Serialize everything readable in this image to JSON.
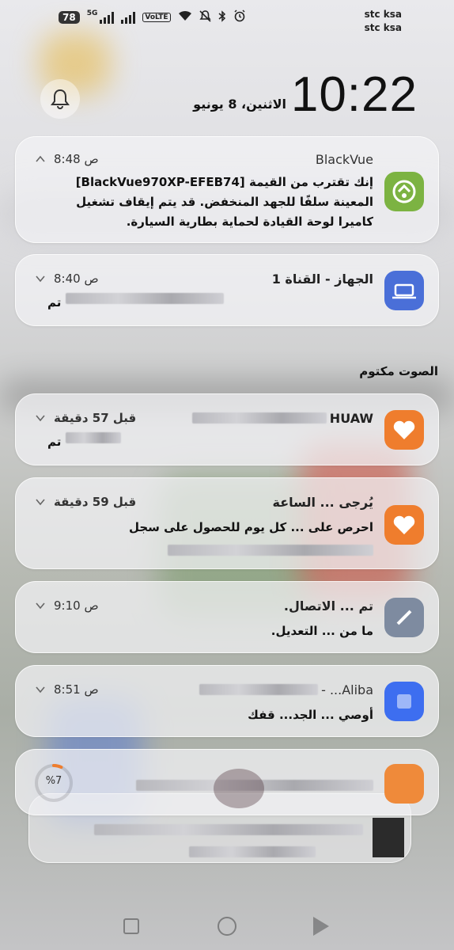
{
  "status_bar": {
    "battery": "78",
    "network": "5G",
    "volte": "VoLTE",
    "carrier_line1": "stc ksa",
    "carrier_line2": "stc ksa"
  },
  "lockscreen": {
    "time": "10:22",
    "date": "الاثنين، 8 يونيو"
  },
  "notifications": [
    {
      "app": "BlackVue",
      "time": "8:48 ص",
      "body": "إنك تقترب من القيمة [BlackVue970XP-EFEB74] المعينة سلفًا للجهد المنخفض. قد يتم إيقاف تشغيل كاميرا لوحة القيادة لحماية بطارية السيارة.",
      "icon_color": "#7cb342"
    },
    {
      "title": "الجهاز - القناة 1",
      "time": "8:40 ص",
      "body": "تم",
      "icon_color": "#4a6fd8"
    }
  ],
  "silent_section": {
    "label": "الصوت مكتوم"
  },
  "silent_notifications": [
    {
      "title": "HUAW",
      "time": "قبل 57 دقيقة",
      "body": "تم",
      "icon_color": "#ef7d2d"
    },
    {
      "title": "يُرجى ... الساعة",
      "time": "قبل 59 دقيقة",
      "body": "احرص على ... كل يوم للحصول على سجل",
      "icon_color": "#ef7d2d"
    },
    {
      "title": "تم ... الاتصال.",
      "time": "9:10 ص",
      "body": "ما من ... التعديل.",
      "icon_color": "#7e8ba0"
    },
    {
      "title": "Aliba... -",
      "time": "8:51 ص",
      "body": "أوصي ... الجد... قفك",
      "icon_color": "#3d6ef0"
    },
    {
      "title": "",
      "time": "",
      "body": "",
      "progress_label": "%7",
      "icon_color": "#ef8a3a"
    }
  ]
}
